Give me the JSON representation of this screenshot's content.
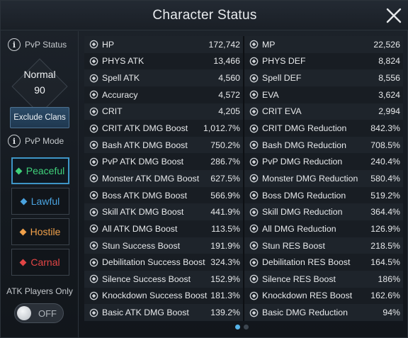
{
  "window": {
    "title": "Character Status"
  },
  "sidebar": {
    "pvp_status_label": "PvP Status",
    "pvp_status_value": "Normal",
    "pvp_status_points": "90",
    "exclude_clans_label": "Exclude Clans",
    "pvp_mode_label": "PvP Mode",
    "modes": [
      {
        "label": "Peaceful",
        "color": "#3fd07a",
        "active": true
      },
      {
        "label": "Lawful",
        "color": "#4aa3e0",
        "active": false
      },
      {
        "label": "Hostile",
        "color": "#f0a04a",
        "active": false
      },
      {
        "label": "Carnal",
        "color": "#e24545",
        "active": false
      }
    ],
    "atk_players_only_label": "ATK Players Only",
    "toggle_label": "OFF"
  },
  "stats": {
    "left": [
      {
        "icon": "heart-icon",
        "label": "HP",
        "value": "172,742"
      },
      {
        "icon": "sword-icon",
        "label": "PHYS ATK",
        "value": "13,466"
      },
      {
        "icon": "spell-icon",
        "label": "Spell ATK",
        "value": "4,560"
      },
      {
        "icon": "target-icon",
        "label": "Accuracy",
        "value": "4,572"
      },
      {
        "icon": "claw-icon",
        "label": "CRIT",
        "value": "4,205"
      },
      {
        "icon": "shield-icon",
        "label": "CRIT ATK DMG Boost",
        "value": "1,012.7%"
      },
      {
        "icon": "bash-icon",
        "label": "Bash ATK DMG Boost",
        "value": "750.2%"
      },
      {
        "icon": "pvp-icon",
        "label": "PvP ATK DMG Boost",
        "value": "286.7%"
      },
      {
        "icon": "monster-icon",
        "label": "Monster ATK DMG Boost",
        "value": "627.5%"
      },
      {
        "icon": "boss-icon",
        "label": "Boss ATK DMG Boost",
        "value": "566.9%"
      },
      {
        "icon": "skill-icon",
        "label": "Skill ATK DMG Boost",
        "value": "441.9%"
      },
      {
        "icon": "crown-icon",
        "label": "All ATK DMG Boost",
        "value": "113.5%"
      },
      {
        "icon": "stun-icon",
        "label": "Stun Success Boost",
        "value": "191.9%"
      },
      {
        "icon": "debilitation-icon",
        "label": "Debilitation Success Boost",
        "value": "324.3%"
      },
      {
        "icon": "silence-icon",
        "label": "Silence Success Boost",
        "value": "152.9%"
      },
      {
        "icon": "knockdown-icon",
        "label": "Knockdown Success Boost",
        "value": "181.3%"
      },
      {
        "icon": "crossed-swords-icon",
        "label": "Basic ATK DMG Boost",
        "value": "139.2%"
      }
    ],
    "right": [
      {
        "icon": "mana-icon",
        "label": "MP",
        "value": "22,526"
      },
      {
        "icon": "armor-icon",
        "label": "PHYS DEF",
        "value": "8,824"
      },
      {
        "icon": "spell-def-icon",
        "label": "Spell DEF",
        "value": "8,556"
      },
      {
        "icon": "eva-icon",
        "label": "EVA",
        "value": "3,624"
      },
      {
        "icon": "dodge-icon",
        "label": "CRIT EVA",
        "value": "2,994"
      },
      {
        "icon": "crit-reduction-icon",
        "label": "CRIT DMG Reduction",
        "value": "842.3%"
      },
      {
        "icon": "bash-reduction-icon",
        "label": "Bash DMG Reduction",
        "value": "708.5%"
      },
      {
        "icon": "pvp-reduction-icon",
        "label": "PvP DMG Reduction",
        "value": "240.4%"
      },
      {
        "icon": "monster-reduction-icon",
        "label": "Monster DMG Reduction",
        "value": "580.4%"
      },
      {
        "icon": "boss-reduction-icon",
        "label": "Boss DMG Reduction",
        "value": "519.2%"
      },
      {
        "icon": "skill-reduction-icon",
        "label": "Skill DMG Reduction",
        "value": "364.4%"
      },
      {
        "icon": "all-reduction-icon",
        "label": "All DMG Reduction",
        "value": "126.9%"
      },
      {
        "icon": "stun-res-icon",
        "label": "Stun RES Boost",
        "value": "218.5%"
      },
      {
        "icon": "debilitation-res-icon",
        "label": "Debilitation RES Boost",
        "value": "164.5%"
      },
      {
        "icon": "silence-res-icon",
        "label": "Silence RES Boost",
        "value": "186%"
      },
      {
        "icon": "knockdown-res-icon",
        "label": "Knockdown RES Boost",
        "value": "162.6%"
      },
      {
        "icon": "basic-reduction-icon",
        "label": "Basic DMG Reduction",
        "value": "94%"
      }
    ]
  },
  "pagination": {
    "pages": 2,
    "current": 1
  }
}
